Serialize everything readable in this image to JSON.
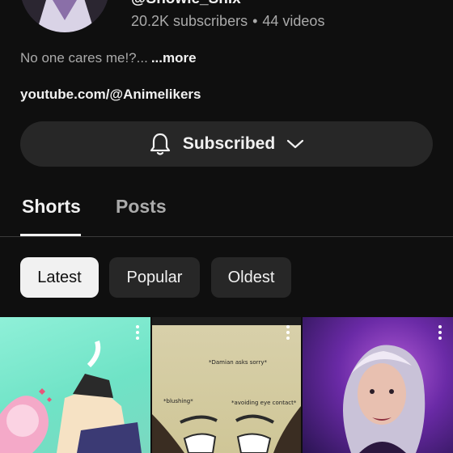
{
  "channel": {
    "handle": "@Snowie_Shix",
    "subscribers": "20.2K subscribers",
    "separator": "•",
    "videos": "44 videos",
    "description": "No one cares me!?...",
    "more_label": "...more",
    "link": "youtube.com/@Animelikers"
  },
  "subscribe": {
    "label": "Subscribed"
  },
  "tabs": [
    {
      "label": "Shorts",
      "active": true
    },
    {
      "label": "Posts",
      "active": false
    }
  ],
  "chips": [
    {
      "label": "Latest",
      "selected": true
    },
    {
      "label": "Popular",
      "selected": false
    },
    {
      "label": "Oldest",
      "selected": false
    }
  ],
  "shorts": [
    {
      "caption": ""
    },
    {
      "caption_top": "*Damian asks sorry*",
      "caption_left": "*blushing*",
      "caption_right": "*avoiding eye contact*"
    },
    {
      "caption": ""
    }
  ],
  "colors": {
    "background": "#0f0f0f",
    "chip_selected": "#f1f1f1",
    "chip": "#272727"
  }
}
